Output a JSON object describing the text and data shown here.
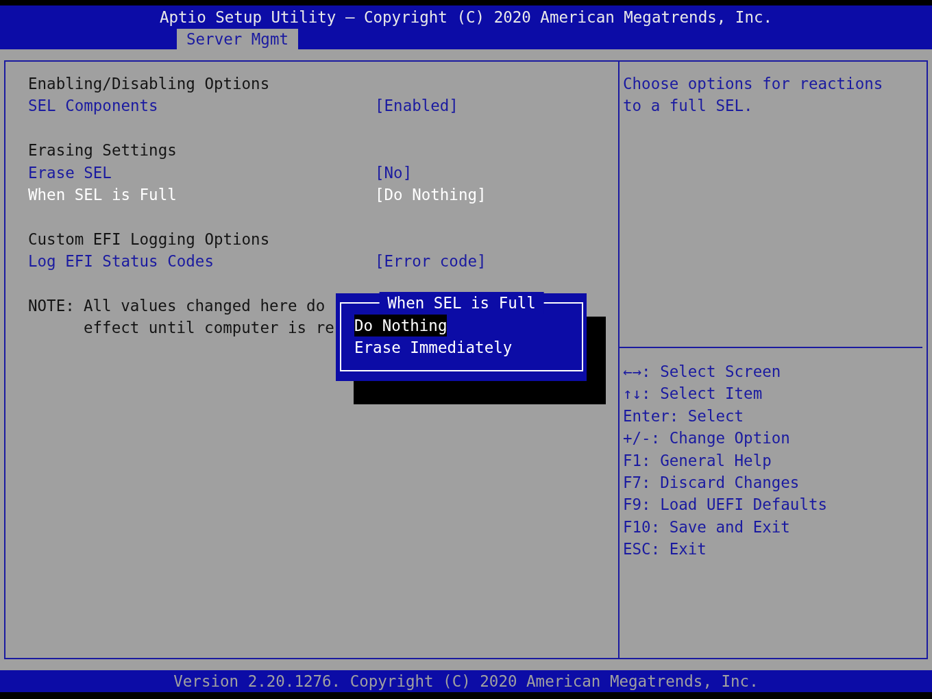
{
  "window": {
    "title": "Aptio Setup Utility – Copyright (C) 2020 American Megatrends, Inc."
  },
  "tabs": [
    {
      "label": "Server Mgmt",
      "selected": true
    }
  ],
  "sections": [
    {
      "title": "Enabling/Disabling Options",
      "settings": [
        {
          "label": "SEL Components",
          "value": "[Enabled]",
          "selected": false
        }
      ]
    },
    {
      "title": "Erasing Settings",
      "settings": [
        {
          "label": "Erase SEL",
          "value": "[No]",
          "selected": false
        },
        {
          "label": "When SEL is Full",
          "value": "[Do Nothing]",
          "selected": true
        }
      ]
    },
    {
      "title": "Custom EFI Logging Options",
      "settings": [
        {
          "label": "Log EFI Status Codes",
          "value": "[Error code]",
          "selected": false
        }
      ]
    }
  ],
  "note": {
    "label": "NOTE:",
    "lines": [
      "All values changed here do",
      "effect until computer is re"
    ]
  },
  "popup": {
    "title": "When SEL is Full",
    "options": [
      {
        "label": "Do Nothing",
        "selected": true
      },
      {
        "label": "Erase Immediately",
        "selected": false
      }
    ]
  },
  "help": {
    "lines": [
      "Choose options for reactions",
      "to a full SEL."
    ]
  },
  "key_hints": [
    "←→: Select Screen",
    "↑↓: Select Item",
    "Enter: Select",
    "+/-: Change Option",
    "F1: General Help",
    "F7: Discard Changes",
    "F9: Load UEFI Defaults",
    "F10: Save and Exit",
    "ESC: Exit"
  ],
  "status_bar": "Version 2.20.1276. Copyright (C) 2020 American Megatrends, Inc."
}
